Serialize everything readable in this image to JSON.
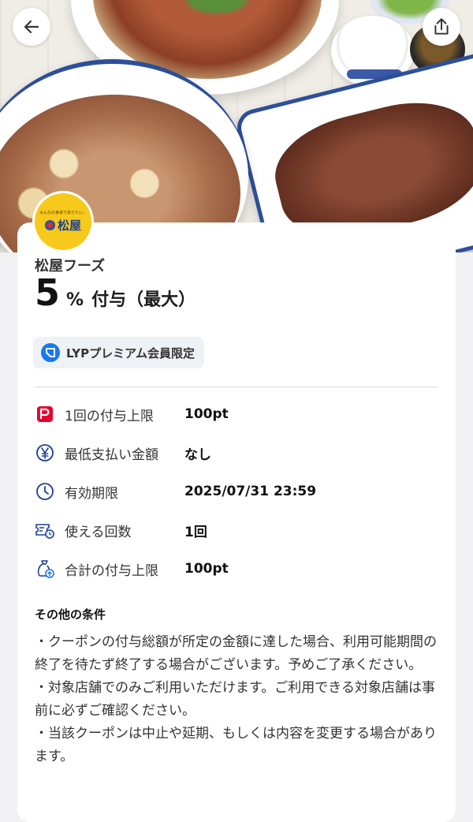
{
  "header": {
    "back_icon": "arrow-left-icon",
    "share_icon": "share-upload-icon"
  },
  "store": {
    "logo_tagline": "みんなの食卓でありたい。",
    "logo_text": "松屋",
    "name": "松屋フーズ"
  },
  "reward": {
    "rate": "5",
    "unit": "%",
    "label": "付与（最大）"
  },
  "badge": {
    "label": "LYPプレミアム会員限定",
    "icon": "lyp-premium-icon",
    "color": "#1a78ee"
  },
  "details": [
    {
      "icon": "paypay-icon",
      "label": "1回の付与上限",
      "value": "100pt"
    },
    {
      "icon": "yen-icon",
      "label": "最低支払い金額",
      "value": "なし"
    },
    {
      "icon": "clock-icon",
      "label": "有効期限",
      "value": "2025/07/31 23:59"
    },
    {
      "icon": "ticket-clock-icon",
      "label": "使える回数",
      "value": "1回"
    },
    {
      "icon": "money-bag-icon",
      "label": "合計の付与上限",
      "value": "100pt"
    }
  ],
  "conditions": {
    "heading": "その他の条件",
    "items": [
      "・クーポンの付与総額が所定の金額に達した場合、利用可能期間の終了を待たず終了する場合がございます。予めご了承ください。",
      "・対象店舗でのみご利用いただけます。ご利用できる対象店舗は事前に必ずご確認ください。",
      "・当該クーポンは中止や延期、もしくは内容を変更する場合があります。"
    ]
  },
  "colors": {
    "paypay_red": "#e8002d",
    "navy": "#1d3f95",
    "logo_yellow": "#f7c91b"
  }
}
